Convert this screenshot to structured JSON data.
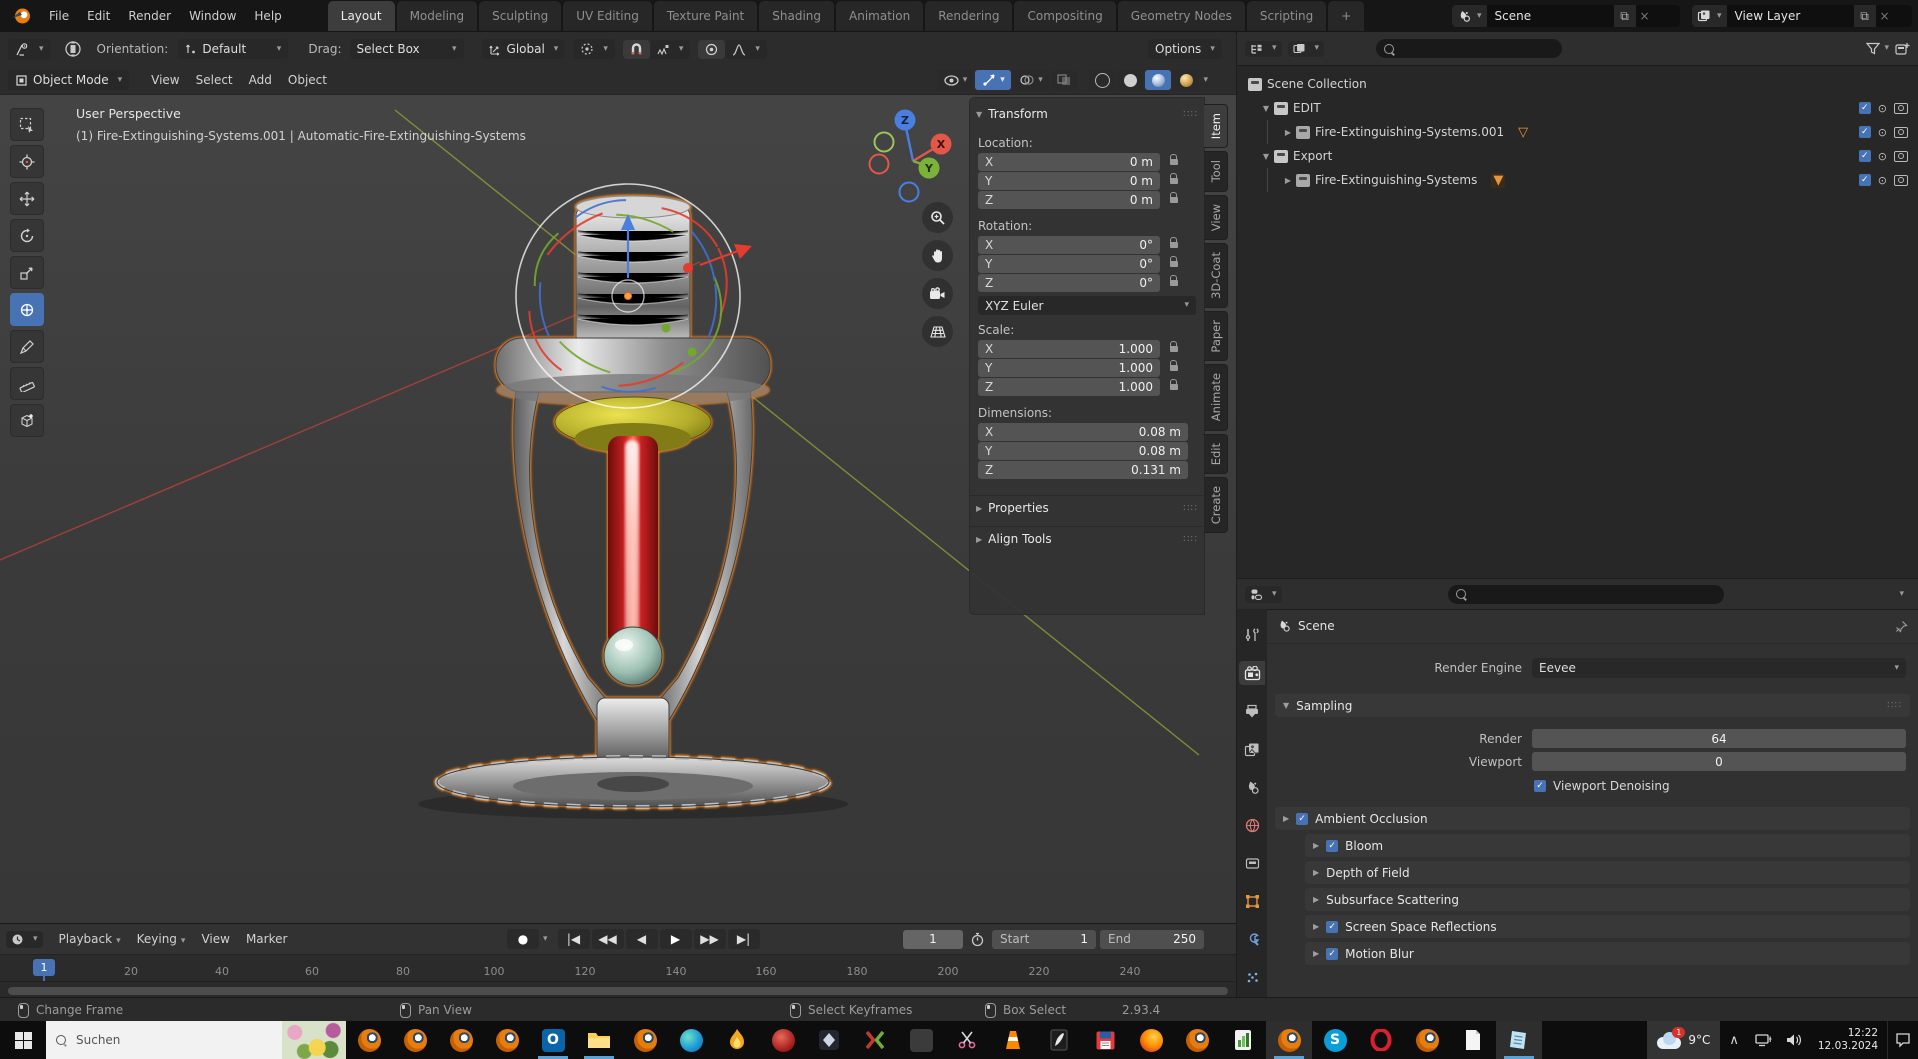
{
  "icons": {
    "chevron": "▾",
    "caret_open": "▼",
    "caret_closed": "▶",
    "check": "✓",
    "grip": "∷∷",
    "close": "×",
    "copy": "⧉",
    "mesh_outline_badge": "▽",
    "mesh_filled_badge": "▼",
    "record_dot": "●",
    "jump_start": "|◀",
    "prev_key": "◀◀",
    "prev": "◀",
    "play": "▶",
    "next_key": "▶▶",
    "jump_end": "▶|",
    "tray_chevron": "∧"
  },
  "topbar": {
    "menus": [
      "File",
      "Edit",
      "Render",
      "Window",
      "Help"
    ],
    "workspaces": [
      "Layout",
      "Modeling",
      "Sculpting",
      "UV Editing",
      "Texture Paint",
      "Shading",
      "Animation",
      "Rendering",
      "Compositing",
      "Geometry Nodes",
      "Scripting"
    ],
    "active_workspace": "Layout",
    "new_workspace_button": "+",
    "scene_name": "Scene",
    "view_layer_name": "View Layer"
  },
  "tool_settings": {
    "orientation_label": "Orientation:",
    "orientation_value": "Default",
    "drag_label": "Drag:",
    "drag_value": "Select Box",
    "transform_space": "Global",
    "options_label": "Options"
  },
  "viewport": {
    "mode": "Object Mode",
    "menus": [
      "View",
      "Select",
      "Add",
      "Object"
    ],
    "view_name": "User Perspective",
    "object_info": "(1) Fire-Extinguishing-Systems.001 | Automatic-Fire-Extinguishing-Systems",
    "axis": {
      "x": "X",
      "y": "Y",
      "z": "Z"
    }
  },
  "npanel": {
    "tabs": [
      "Item",
      "Tool",
      "View",
      "3D-Coat",
      "Paper",
      "Animate",
      "Edit",
      "Create"
    ],
    "active_tab": "Item",
    "transform_title": "Transform",
    "location_label": "Location:",
    "rotation_label": "Rotation:",
    "scale_label": "Scale:",
    "dimensions_label": "Dimensions:",
    "axis_x": "X",
    "axis_y": "Y",
    "axis_z": "Z",
    "location": {
      "x": "0 m",
      "y": "0 m",
      "z": "0 m"
    },
    "rotation": {
      "x": "0°",
      "y": "0°",
      "z": "0°"
    },
    "euler_mode": "XYZ Euler",
    "scale": {
      "x": "1.000",
      "y": "1.000",
      "z": "1.000"
    },
    "dimensions": {
      "x": "0.08 m",
      "y": "0.08 m",
      "z": "0.131 m"
    },
    "collapsed_panels": [
      "Properties",
      "Align Tools"
    ]
  },
  "outliner": {
    "rows": [
      {
        "label": "Scene Collection"
      },
      {
        "label": "EDIT"
      },
      {
        "label": "Fire-Extinguishing-Systems.001"
      },
      {
        "label": "Export"
      },
      {
        "label": "Fire-Extinguishing-Systems"
      }
    ]
  },
  "properties": {
    "breadcrumb": "Scene",
    "render_engine_label": "Render Engine",
    "render_engine_value": "Eevee",
    "sampling_title": "Sampling",
    "render_label": "Render",
    "render_samples": "64",
    "viewport_label": "Viewport",
    "viewport_samples": "0",
    "denoising_label": "Viewport Denoising",
    "sections": [
      {
        "label": "Ambient Occlusion",
        "checked": true
      },
      {
        "label": "Bloom",
        "checked": true
      },
      {
        "label": "Depth of Field",
        "checked": false
      },
      {
        "label": "Subsurface Scattering",
        "checked": false
      },
      {
        "label": "Screen Space Reflections",
        "checked": true
      },
      {
        "label": "Motion Blur",
        "checked": true
      }
    ]
  },
  "timeline": {
    "menus": [
      "Playback",
      "Keying",
      "View",
      "Marker"
    ],
    "current_frame": "1",
    "start_label": "Start",
    "start_value": "1",
    "end_label": "End",
    "end_value": "250",
    "ticks": [
      "20",
      "40",
      "60",
      "80",
      "100",
      "120",
      "140",
      "160",
      "180",
      "200",
      "220",
      "240"
    ]
  },
  "statusbar": {
    "hints": [
      "Change Frame",
      "Pan View",
      "Select Keyframes",
      "Box Select"
    ],
    "version": "2.93.4"
  },
  "taskbar": {
    "search": "Suchen",
    "weather_badge": "1",
    "temperature": "9°C",
    "time": "12:22",
    "date": "12.03.2024"
  },
  "colors": {
    "accent": "#4772b3",
    "selection_outline": "#ff8a1e",
    "axis_x": "#e3352e",
    "axis_y": "#6ba62b",
    "axis_z": "#3d6fd8"
  }
}
